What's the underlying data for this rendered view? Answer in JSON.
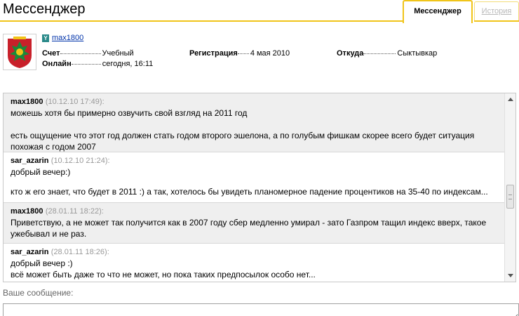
{
  "header": {
    "title": "Мессенджер",
    "tabs": [
      {
        "label": "Мессенджер",
        "active": true
      },
      {
        "label": "История",
        "active": false
      }
    ]
  },
  "profile": {
    "username": "max1800",
    "fields": {
      "account": {
        "label": "Счет",
        "value": "Учебный"
      },
      "registration": {
        "label": "Регистрация",
        "value": "4 мая 2010"
      },
      "from": {
        "label": "Откуда",
        "value": "Сыктывкар"
      },
      "online": {
        "label": "Онлайн",
        "value": "сегодня, 16:11"
      }
    }
  },
  "messages": [
    {
      "author": "max1800",
      "time": "(10.12.10 17:49):",
      "lines": [
        "можешь хотя бы примерно озвучить свой взгляд на 2011 год",
        "",
        "есть ощущение что этот год должен стать годом второго эшелона, а по голубым фишкам скорее всего будет ситуация похожая с годом 2007"
      ]
    },
    {
      "author": "sar_azarin",
      "time": "(10.12.10 21:24):",
      "lines": [
        "добрый вечер:)",
        "",
        "кто ж его знает, что будет в 2011 :) а так, хотелось бы увидеть планомерное падение процентиков на 35-40 по индексам..."
      ]
    },
    {
      "author": "max1800",
      "time": "(28.01.11 18:22):",
      "lines": [
        "Приветствую, а не может так получится как в 2007 году сбер медленно умирал - зато Газпром тащил индекс вверх, такое ужебывал и не раз."
      ]
    },
    {
      "author": "sar_azarin",
      "time": "(28.01.11 18:26):",
      "lines": [
        "добрый вечер :)",
        "всё может быть даже то что не может, но пока таких предпосылок особо нет..."
      ]
    }
  ],
  "compose": {
    "label": "Ваше сообщение:",
    "value": ""
  }
}
